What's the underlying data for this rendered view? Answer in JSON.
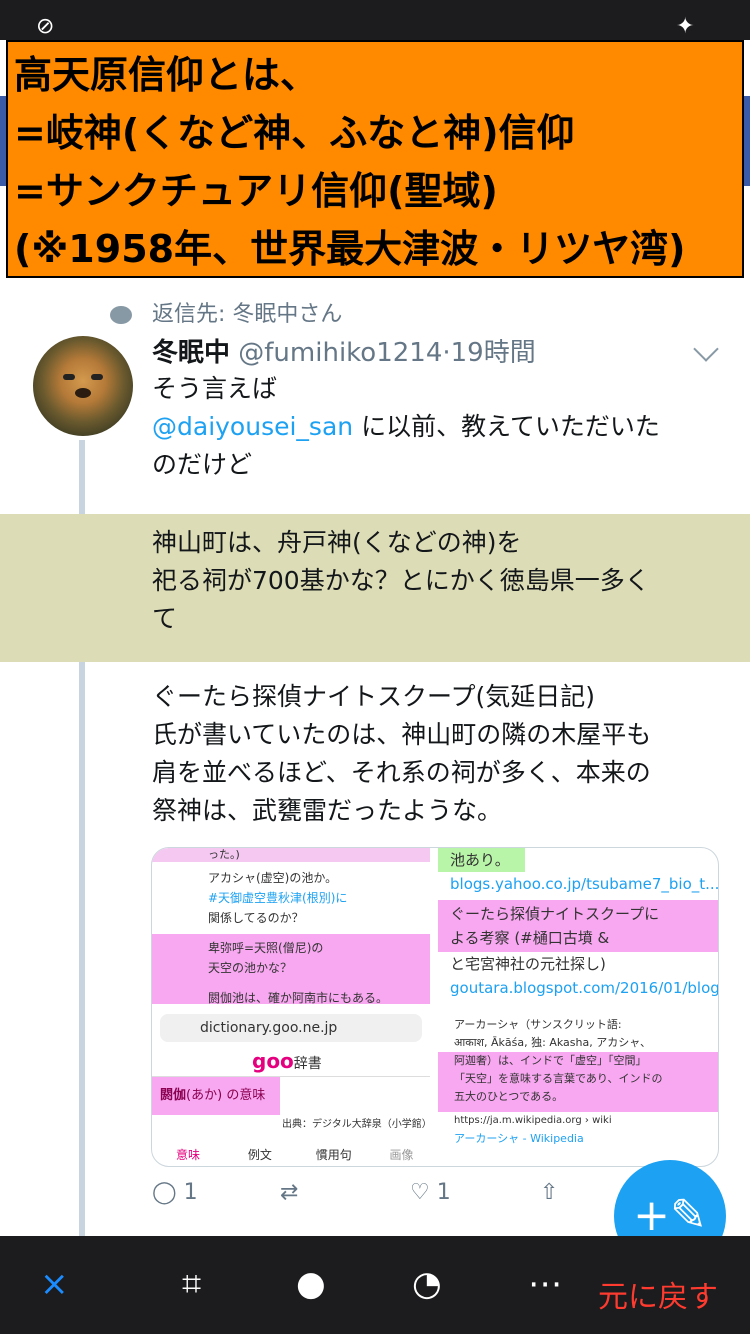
{
  "overlay_lines": [
    "高天原信仰とは、",
    "=岐神(くなど神、ふなと神)信仰",
    "=サンクチュアリ信仰(聖域)",
    "(※1958年、世界最大津波・リツヤ湾)"
  ],
  "reply_context": "返信先: 冬眠中さん",
  "tweet": {
    "name": "冬眠中",
    "handle": "@fumihiko1214",
    "dot": "·",
    "time": "19時間",
    "line1": "そう言えば",
    "mention": "@daiyousei_san",
    "line2a": " に以前、教えていただいた",
    "line2b": "のだけど",
    "highlight_lines": [
      "神山町は、舟戸神(くなどの神)を",
      "祀る祠が700基かな？とにかく徳島県一多く",
      "て"
    ],
    "para_lines": [
      "ぐーたら探偵ナイトスクープ(気延日記)",
      "氏が書いていたのは、神山町の隣の木屋平も",
      "肩を並べるほど、それ系の祠が多く、本来の",
      "祭神は、武甕雷だったような。"
    ]
  },
  "media": {
    "tl": [
      "った。)",
      "アカシャ(虚空)の池か。",
      "#天御虚空豊秋津(根別)に",
      "関係してるのか？",
      "卑弥呼=天照(僧尼)の",
      "天空の池かな？",
      "閼伽池は、確か阿南市にもある。"
    ],
    "tr": [
      "池あり。",
      "blogs.yahoo.co.jp/tsubame7_bio_t...",
      "ぐーたら探偵ナイトスクープに",
      "よる考察 (#樋口古墳 &",
      "と宅宮神社の元社探し)",
      "goutara.blogspot.com/2016/01/blog-"
    ],
    "bl": {
      "url": "dictionary.goo.ne.jp",
      "brand": "goo",
      "brand_suffix": "辞書",
      "entry": "閼伽",
      "reading": "(あか)",
      "meaning": "の意味",
      "source": "出典：デジタル大辞泉（小学館）",
      "tabs": [
        "意味",
        "例文",
        "慣用句",
        "画像"
      ]
    },
    "br": [
      "アーカーシャ（サンスクリット語:",
      "आकाश, Ākāśa, 独: Akasha, アカシャ、",
      "阿迦奢）は、インドで「虚空」「空間」",
      "「天空」を意味する言葉であり、インドの",
      "五大のひとつである。",
      "https://ja.m.wikipedia.org › wiki",
      "アーカーシャ - Wikipedia"
    ]
  },
  "actions": {
    "reply_count": "1",
    "like_count": "1"
  },
  "bottom": {
    "cancel": "×",
    "restore": "元に戻す"
  }
}
